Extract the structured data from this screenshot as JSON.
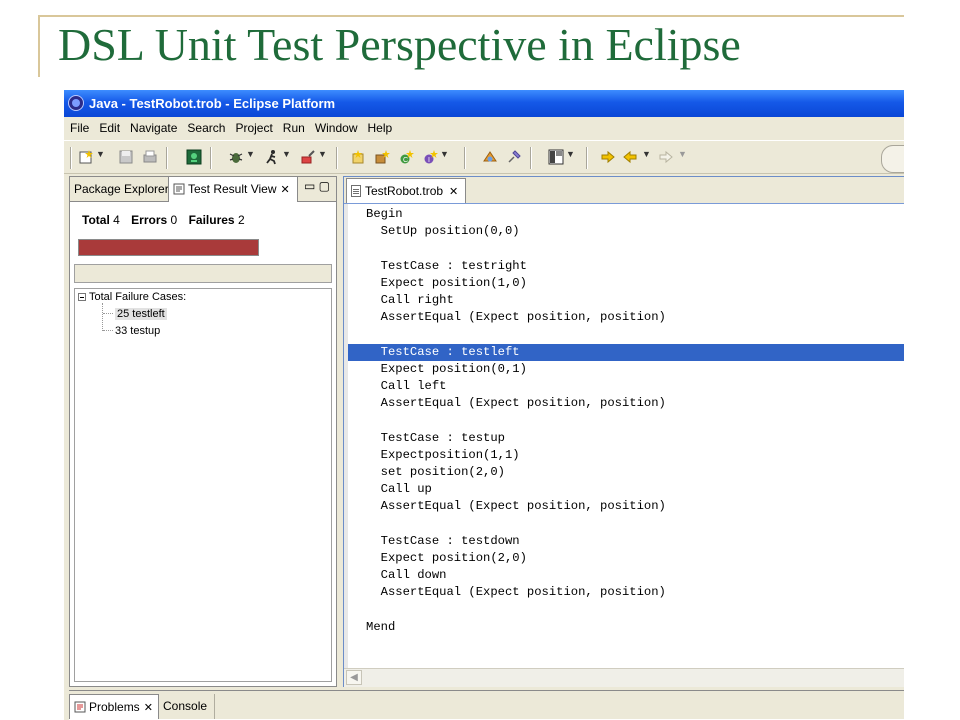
{
  "slide": {
    "title": "DSL Unit Test Perspective in Eclipse"
  },
  "window": {
    "title": "Java - TestRobot.trob - Eclipse Platform"
  },
  "menu": [
    "File",
    "Edit",
    "Navigate",
    "Search",
    "Project",
    "Run",
    "Window",
    "Help"
  ],
  "toolbar": {
    "icons": [
      "new-wizard-icon",
      "save-icon",
      "print-icon",
      "robot-icon",
      "debug-icon",
      "run-icon",
      "external-tools-icon",
      "open-type-icon",
      "new-package-icon",
      "new-class-icon",
      "new-interface-icon",
      "search-icon",
      "pin-icon",
      "open-perspective-icon",
      "next-annotation-icon",
      "back-icon",
      "forward-icon"
    ]
  },
  "left_view": {
    "tabs": {
      "inactive": "Package Explorer",
      "active": "Test Result View"
    },
    "summary": {
      "total_label": "Total",
      "total": "4",
      "errors_label": "Errors",
      "errors": "0",
      "failures_label": "Failures",
      "failures": "2"
    },
    "progress": {
      "fraction": 1.0,
      "color": "#a93a3a"
    },
    "tree": {
      "root": "Total Failure Cases:",
      "children": [
        "25 testleft",
        "33 testup"
      ]
    }
  },
  "editor": {
    "tab": "TestRobot.trob",
    "highlight_color": "#3164c6",
    "lines": [
      "Begin",
      "  SetUp position(0,0)",
      "",
      "  TestCase : testright",
      "  Expect position(1,0)",
      "  Call right",
      "  AssertEqual (Expect position, position)",
      "",
      "  TestCase : testleft",
      "  Expect position(0,1)",
      "  Call left",
      "  AssertEqual (Expect position, position)",
      "",
      "  TestCase : testup",
      "  Expectposition(1,1)",
      "  set position(2,0)",
      "  Call up",
      "  AssertEqual (Expect position, position)",
      "",
      "  TestCase : testdown",
      "  Expect position(2,0)",
      "  Call down",
      "  AssertEqual (Expect position, position)",
      "",
      "Mend"
    ],
    "highlighted_line": 8
  },
  "bottom": {
    "tabs": {
      "active": "Problems",
      "inactive": "Console"
    }
  }
}
